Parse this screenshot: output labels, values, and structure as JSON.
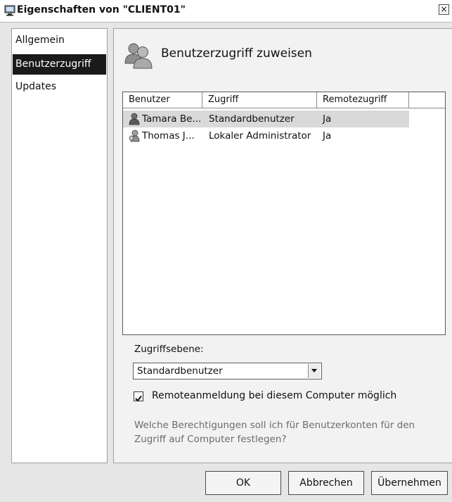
{
  "window": {
    "title": "Eigenschaften von \"CLIENT01\"",
    "close_label": "×"
  },
  "nav": {
    "items": [
      {
        "label": "Allgemein",
        "selected": false
      },
      {
        "label": "Benutzerzugriff",
        "selected": true
      },
      {
        "label": "Updates",
        "selected": false
      }
    ]
  },
  "panel": {
    "title": "Benutzerzugriff zuweisen",
    "table": {
      "columns": [
        "Benutzer",
        "Zugriff",
        "Remotezugriff"
      ],
      "rows": [
        {
          "user": "Tamara Be...",
          "access": "Standardbenutzer",
          "remote": "Ja",
          "selected": true
        },
        {
          "user": "Thomas J...",
          "access": "Lokaler Administrator",
          "remote": "Ja",
          "selected": false
        }
      ]
    },
    "access_level_label": "Zugriffsebene:",
    "access_level_value": "Standardbenutzer",
    "remote_checkbox": {
      "label": "Remoteanmeldung bei diesem Computer möglich",
      "checked": true
    },
    "help_text": "Welche Berechtigungen soll ich für Benutzerkonten für den Zugriff auf Computer festlegen?"
  },
  "buttons": {
    "ok": "OK",
    "cancel": "Abbrechen",
    "apply": "Übernehmen"
  }
}
